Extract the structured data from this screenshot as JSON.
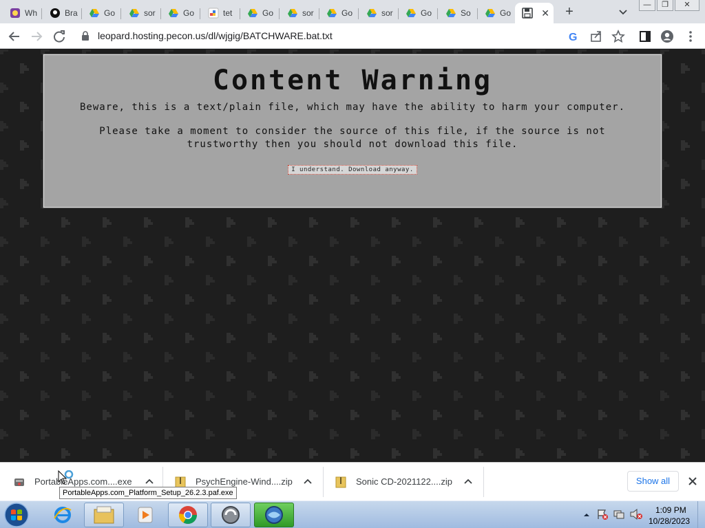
{
  "browser": {
    "tabs": [
      {
        "label": "Wh",
        "favicon": "scratch-icon",
        "color": "#7b3fa0"
      },
      {
        "label": "Bra",
        "favicon": "github-icon",
        "color": "#111111"
      },
      {
        "label": "Go",
        "favicon": "google-drive-icon",
        "color": "#34a853"
      },
      {
        "label": "sor",
        "favicon": "google-drive-icon",
        "color": "#34a853"
      },
      {
        "label": "Go",
        "favicon": "google-drive-icon",
        "color": "#34a853"
      },
      {
        "label": "tet",
        "favicon": "tetris-icon",
        "color": "#e04848"
      },
      {
        "label": "Go",
        "favicon": "google-drive-icon",
        "color": "#34a853"
      },
      {
        "label": "sor",
        "favicon": "google-drive-icon",
        "color": "#34a853"
      },
      {
        "label": "Go",
        "favicon": "google-drive-icon",
        "color": "#34a853"
      },
      {
        "label": "sor",
        "favicon": "google-drive-icon",
        "color": "#34a853"
      },
      {
        "label": "Go",
        "favicon": "google-drive-icon",
        "color": "#34a853"
      },
      {
        "label": "So",
        "favicon": "google-drive-icon",
        "color": "#34a853"
      },
      {
        "label": "Go",
        "favicon": "google-drive-icon",
        "color": "#34a853"
      }
    ],
    "active_tab": {
      "favicon": "save-disk-icon",
      "close": "✕"
    },
    "new_tab": "+",
    "url": "leopard.hosting.pecon.us/dl/wjgig/BATCHWARE.bat.txt"
  },
  "page": {
    "title": "Content Warning",
    "line1": "Beware, this is a text/plain file, which may have the ability to harm your computer.",
    "line2": "Please take a moment to consider the source of this file, if the source is not trustworthy then you should not download this file.",
    "button": "I understand. Download anyway.",
    "background_color": "#1e1e1e",
    "box_color": "#a4a4a4"
  },
  "downloads": {
    "items": [
      {
        "name": "PortableApps.com....exe",
        "icon": "installer-icon"
      },
      {
        "name": "PsychEngine-Wind....zip",
        "icon": "zip-folder-icon"
      },
      {
        "name": "Sonic CD-2021122....zip",
        "icon": "zip-folder-icon"
      }
    ],
    "show_all": "Show all",
    "tooltip": "PortableApps.com_Platform_Setup_26.2.3.paf.exe"
  },
  "taskbar": {
    "time": "1:09 PM",
    "date": "10/28/2023",
    "apps": [
      "internet-explorer-icon",
      "file-explorer-icon",
      "media-player-icon",
      "chrome-icon",
      "app-icon",
      "app-active-icon"
    ]
  }
}
